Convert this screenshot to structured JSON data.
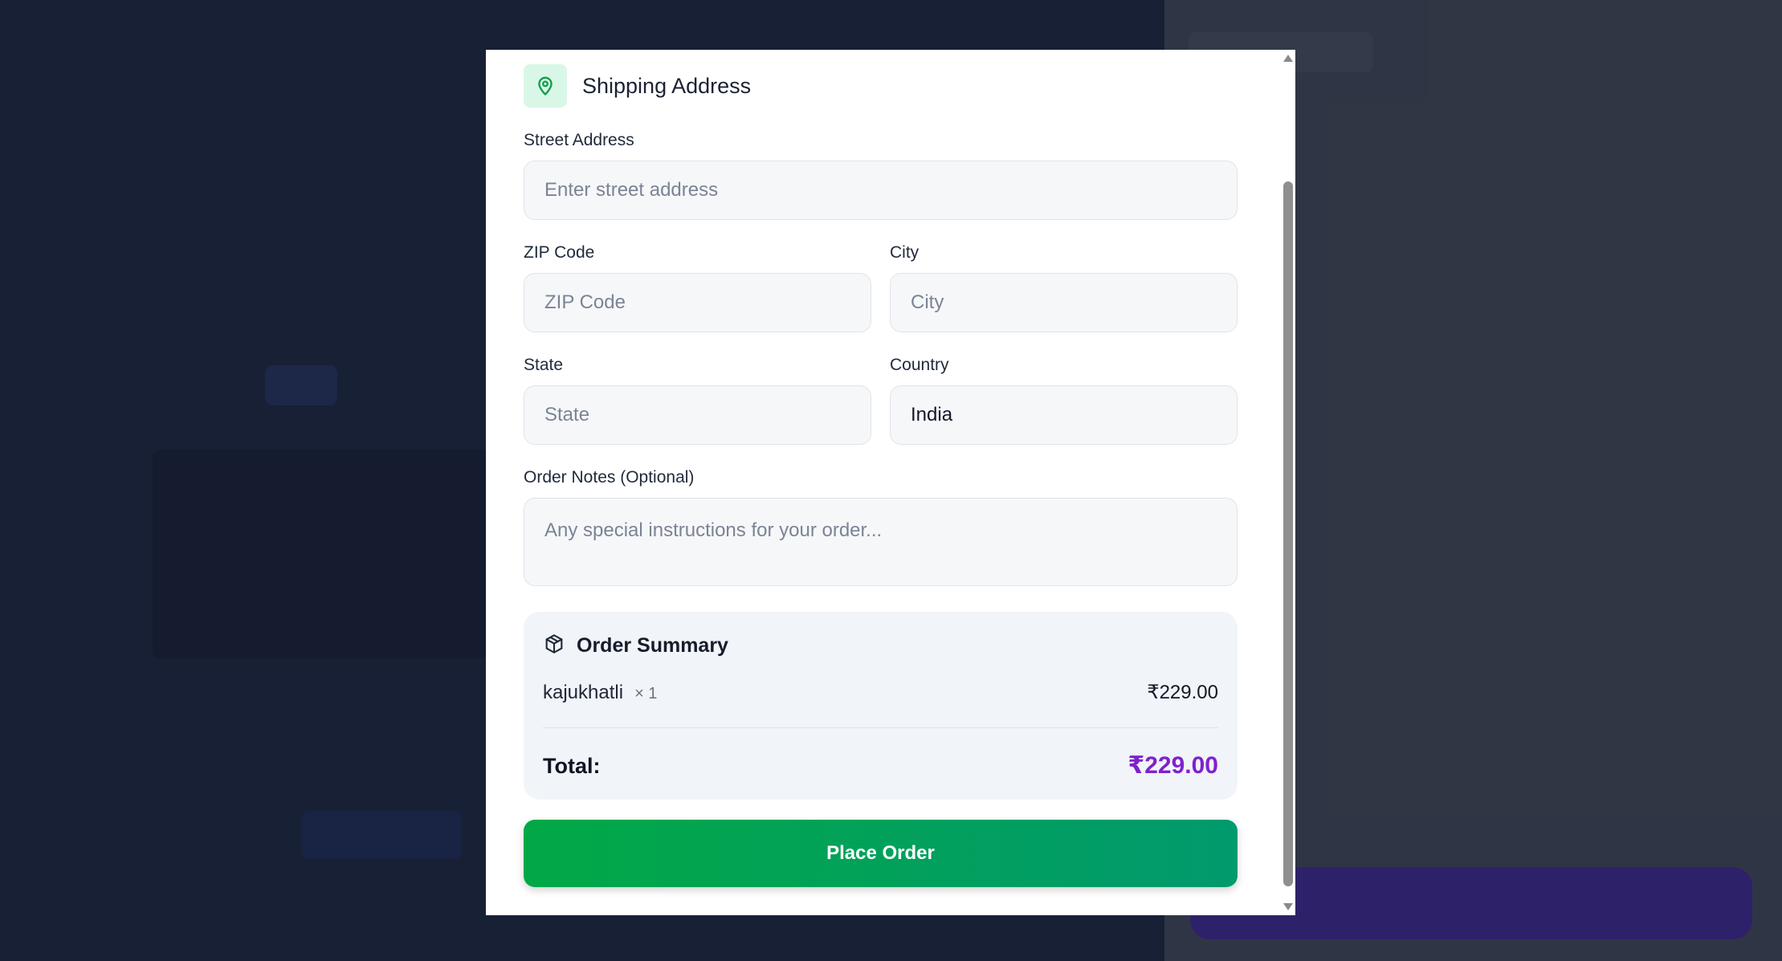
{
  "section": {
    "title": "Shipping Address",
    "icon": "map-pin-icon"
  },
  "fields": {
    "street": {
      "label": "Street Address",
      "placeholder": "Enter street address",
      "value": ""
    },
    "zip": {
      "label": "ZIP Code",
      "placeholder": "ZIP Code",
      "value": ""
    },
    "city": {
      "label": "City",
      "placeholder": "City",
      "value": ""
    },
    "state": {
      "label": "State",
      "placeholder": "State",
      "value": ""
    },
    "country": {
      "label": "Country",
      "value": "India"
    },
    "notes": {
      "label": "Order Notes (Optional)",
      "placeholder": "Any special instructions for your order...",
      "value": ""
    }
  },
  "summary": {
    "title": "Order Summary",
    "icon": "package-icon",
    "items": [
      {
        "name": "kajukhatli",
        "qty": "× 1",
        "price": "₹229.00"
      }
    ],
    "total_label": "Total:",
    "total_value": "₹229.00"
  },
  "actions": {
    "place_order": "Place Order"
  },
  "colors": {
    "accent_green": "#02a846",
    "total_purple": "#7e22ce",
    "pin_bg": "#d9f7e6"
  }
}
